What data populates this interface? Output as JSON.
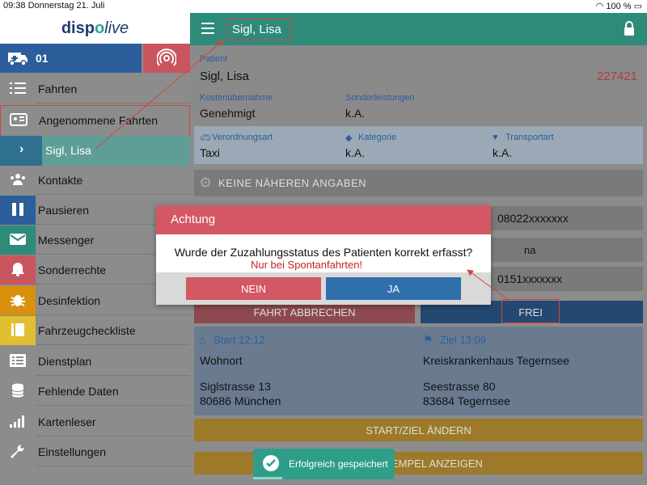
{
  "statusbar": {
    "left": "09:38  Donnerstag 21. Juli",
    "right": "100 %"
  },
  "sidebar": {
    "logo": {
      "part1": "disp",
      "part2": "o",
      "part3": "live"
    },
    "vehicle": "01",
    "items": [
      {
        "label": "Fahrten"
      },
      {
        "label": "Angenommene Fahrten"
      },
      {
        "label": "Kontakte"
      },
      {
        "label": "Pausieren"
      },
      {
        "label": "Messenger"
      },
      {
        "label": "Sonderrechte"
      },
      {
        "label": "Desinfektion"
      },
      {
        "label": "Fahrzeugcheckliste"
      },
      {
        "label": "Dienstplan"
      },
      {
        "label": "Fehlende Daten"
      },
      {
        "label": "Kartenleser"
      },
      {
        "label": "Einstellungen"
      }
    ],
    "sub_item": "Sigl, Lisa",
    "item_colors": [
      "#8c8c8c",
      "#8c8c8c",
      "#2b5e9a",
      "#2b5e9a",
      "#2e8b7a",
      "#c8565f",
      "#d9900c",
      "#e0c030",
      "#8c8c8c",
      "#8c8c8c",
      "#8c8c8c",
      "#8c8c8c"
    ]
  },
  "header": {
    "title": "Sigl, Lisa"
  },
  "patient": {
    "label": "Patient",
    "name": "Sigl, Lisa",
    "id": "227421",
    "cost_label": "Kostenübernahme",
    "cost_value": "Genehmigt",
    "special_label": "Sonderleistungen",
    "special_value": "k.A."
  },
  "details": {
    "prescription_label": "Verordnungsart",
    "prescription_value": "Taxi",
    "category_label": "Kategorie",
    "category_value": "k.A.",
    "transport_label": "Transportart",
    "transport_value": "k.A."
  },
  "no_details": "KEINE NÄHEREN ANGABEN",
  "phone1": "08022xxxxxxx",
  "na": "na",
  "phone2": "0151xxxxxxx",
  "actions": {
    "abort": "FAHRT ABBRECHEN",
    "free": "FREI"
  },
  "start": {
    "label": "Start 12:12",
    "place": "Wohnort",
    "street": "Siglstrasse 13",
    "city": "80686 München"
  },
  "ziel": {
    "label": "Ziel 13:09",
    "place": "Kreiskrankenhaus Tegernsee",
    "street": "Seestrasse 80",
    "city": "83684 Tegernsee"
  },
  "startziel_button": "START/ZIEL ÄNDERN",
  "stamp_button": "EMPEL ANZEIGEN",
  "dialog": {
    "title": "Achtung",
    "question": "Wurde der Zuzahlungsstatus des Patienten korrekt erfasst?",
    "no": "NEIN",
    "yes": "JA"
  },
  "hint": "Nur bei Spontanfahrten!",
  "toast": "Erfolgreich gespeichert",
  "colors": {
    "teal": "#2e8b7a",
    "blue": "#2b5e9a",
    "red": "#d35864",
    "orange": "#d9900c"
  }
}
